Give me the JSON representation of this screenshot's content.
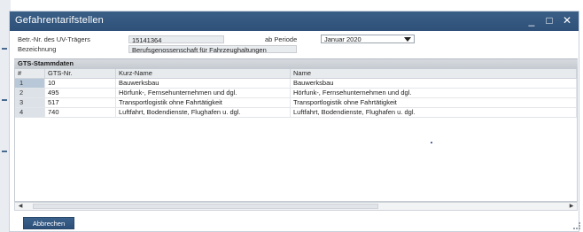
{
  "window": {
    "title": "Gefahrentarifstellen",
    "controls": {
      "minimize": "_",
      "maximize": "□",
      "close": "✕"
    }
  },
  "form": {
    "betr_nr_label": "Betr.-Nr. des UV-Trägers",
    "betr_nr_value": "15141364",
    "ab_periode_label": "ab Periode",
    "ab_periode_value": "Januar 2020",
    "bezeichnung_label": "Bezeichnung",
    "bezeichnung_value": "Berufsgenossenschaft für Fahrzeughaltungen"
  },
  "gts": {
    "section_title": "GTS-Stammdaten",
    "columns": [
      "#",
      "GTS-Nr.",
      "Kurz-Name",
      "Name"
    ],
    "rows": [
      {
        "num": "1",
        "gts_nr": "10",
        "kurz_name": "Bauwerksbau",
        "name": "Bauwerksbau"
      },
      {
        "num": "2",
        "gts_nr": "495",
        "kurz_name": "Hörfunk-, Fernsehunternehmen und dgl.",
        "name": "Hörfunk-, Fernsehunternehmen und dgl."
      },
      {
        "num": "3",
        "gts_nr": "517",
        "kurz_name": "Transportlogistik ohne Fahrtätigkeit",
        "name": "Transportlogistik ohne Fahrtätigkeit"
      },
      {
        "num": "4",
        "gts_nr": "740",
        "kurz_name": "Luftfahrt, Bodendienste, Flughafen u. dgl.",
        "name": "Luftfahrt, Bodendienste, Flughafen u. dgl."
      }
    ]
  },
  "scrollbar": {
    "left_arrow": "◀",
    "right_arrow": "▶"
  },
  "actions": {
    "cancel_label": "Abbrechen"
  },
  "colors": {
    "titlebar": "#2e5079",
    "button": "#2b4f79",
    "section_header": "#c6cbd1"
  }
}
